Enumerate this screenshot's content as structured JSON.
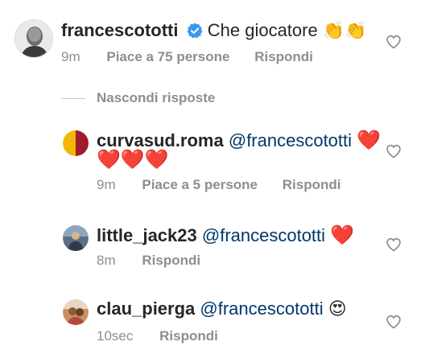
{
  "comments": [
    {
      "username": "francescototti",
      "verified": true,
      "text": "Che giocatore",
      "emoji": "👏👏",
      "time": "9m",
      "likes": "Piace a 75 persone",
      "reply": "Rispondi"
    },
    {
      "username": "curvasud.roma",
      "mention": "@francescototti",
      "emoji_inline": "❤️",
      "emoji_second_line": "❤️❤️❤️",
      "time": "9m",
      "likes": "Piace a 5 persone",
      "reply": "Rispondi"
    },
    {
      "username": "little_jack23",
      "mention": "@francescototti",
      "emoji": "❤️",
      "time": "8m",
      "reply": "Rispondi"
    },
    {
      "username": "clau_pierga",
      "mention": "@francescototti",
      "emoji": "😍",
      "time": "10sec",
      "reply": "Rispondi"
    }
  ],
  "hide_replies_label": "Nascondi risposte",
  "icons": {
    "verified": "verified-badge-icon",
    "like": "heart-outline-icon"
  },
  "colors": {
    "username": "#262626",
    "meta": "#8e8e8e",
    "mention": "#00376b",
    "verified": "#3897f0"
  }
}
